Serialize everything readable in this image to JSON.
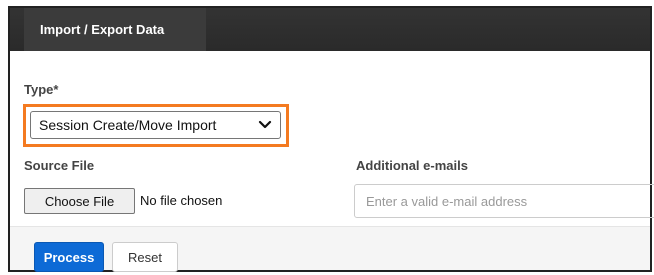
{
  "header": {
    "tab_label": "Import / Export Data"
  },
  "form": {
    "type_label": "Type",
    "type_required_marker": "*",
    "type_selected": "Session Create/Move Import",
    "source_label": "Source File",
    "file_button_label": "Choose File",
    "file_status": "No file chosen",
    "emails_label": "Additional e-mails",
    "emails_placeholder": "Enter a valid e-mail address"
  },
  "actions": {
    "process_label": "Process",
    "reset_label": "Reset"
  },
  "colors": {
    "header_bg": "#333333",
    "highlight": "#f47a20",
    "primary_button": "#0d6ad6"
  },
  "icons": {
    "select_arrow": "chevron-down-icon"
  }
}
